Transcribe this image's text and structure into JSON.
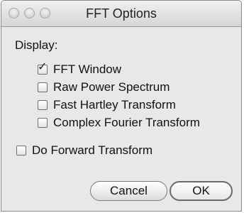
{
  "window": {
    "title": "FFT Options"
  },
  "display": {
    "label": "Display:",
    "options": [
      {
        "label": "FFT Window",
        "checked": true
      },
      {
        "label": "Raw Power Spectrum",
        "checked": false
      },
      {
        "label": "Fast Hartley Transform",
        "checked": false
      },
      {
        "label": "Complex Fourier Transform",
        "checked": false
      }
    ]
  },
  "forward": {
    "label": "Do Forward Transform",
    "checked": false
  },
  "buttons": {
    "cancel": "Cancel",
    "ok": "OK"
  }
}
